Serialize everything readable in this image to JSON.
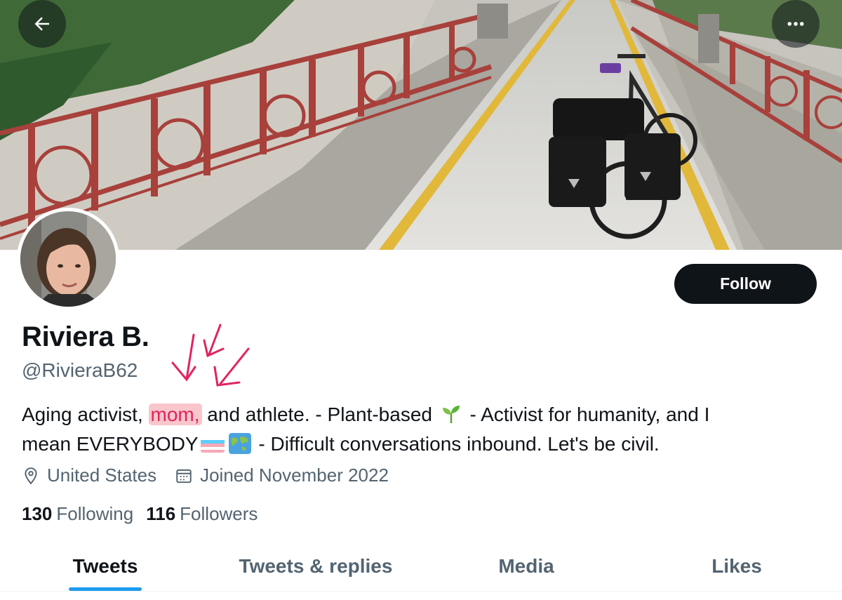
{
  "header": {
    "back_icon": "arrow-left-icon",
    "more_icon": "more-horizontal-icon"
  },
  "banner": {
    "description_icon": "banner-photo"
  },
  "profile": {
    "display_name": "Riviera B.",
    "handle": "@RivieraB62",
    "follow_label": "Follow",
    "bio": {
      "part1": "Aging activist, ",
      "highlight": "mom,",
      "part2": " and athlete. - Plant-based ",
      "part3": " - Activist for humanity, and I",
      "part4": "mean EVERYBODY",
      "part5": " - Difficult conversations inbound. Let's be civil."
    },
    "location": "United States",
    "joined": "Joined November 2022",
    "following_count": "130",
    "following_label": "Following",
    "followers_count": "116",
    "followers_label": "Followers"
  },
  "tabs": [
    {
      "label": "Tweets",
      "active": true
    },
    {
      "label": "Tweets & replies",
      "active": false
    },
    {
      "label": "Media",
      "active": false
    },
    {
      "label": "Likes",
      "active": false
    }
  ],
  "colors": {
    "accent": "#1d9bf0",
    "text_primary": "#0f1419",
    "text_secondary": "#536471",
    "highlight_bg": "#f8c6cb",
    "annotation_red": "#e0245e"
  }
}
